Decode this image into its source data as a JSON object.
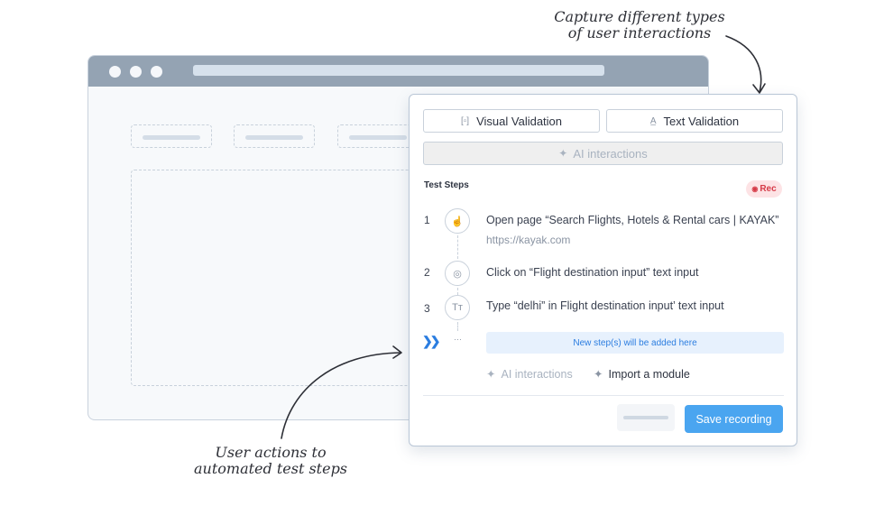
{
  "annotations": {
    "top": [
      "Capture different types",
      "of user interactions"
    ],
    "bottom": [
      "User actions to",
      "automated test steps"
    ]
  },
  "panel": {
    "visual_validation_label": "Visual Validation",
    "text_validation_label": "Text Validation",
    "ai_interactions_label": "AI interactions",
    "test_steps_title": "Test Steps",
    "rec_badge": "Rec",
    "steps": [
      {
        "number": "1",
        "icon": "hand-pointer-icon",
        "text": "Open page “Search Flights, Hotels & Rental cars | KAYAK”",
        "subtext": "https://kayak.com"
      },
      {
        "number": "2",
        "icon": "click-target-icon",
        "text": "Click on “Flight destination input” text input"
      },
      {
        "number": "3",
        "icon": "text-type-icon",
        "text": "Type “delhi” in Flight destination input’ text input"
      }
    ],
    "new_step_note": "New step(s) will be added here",
    "bottom_ai_label": "AI interactions",
    "import_module_label": "Import a module",
    "save_recording_label": "Save recording"
  },
  "colors": {
    "accent": "#4aa5f0",
    "link_blue": "#2b7de0",
    "rec_red": "#d63b48",
    "browser_bar": "#94a3b3"
  }
}
